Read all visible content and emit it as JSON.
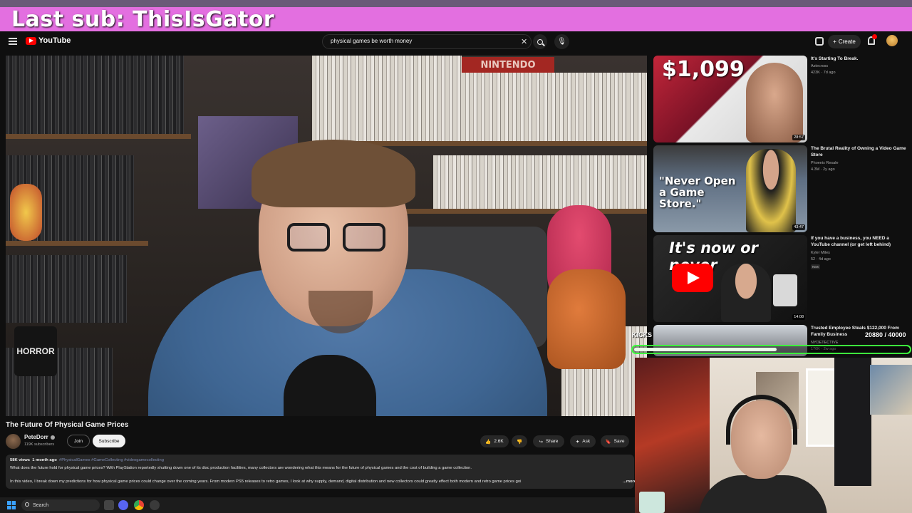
{
  "stream_overlay": {
    "banner": "Last sub: ThisIsGator",
    "goal_label": "KICKS",
    "goal_count": "20880 / 40000",
    "goal_fraction": 0.52
  },
  "header": {
    "logo_text": "YouTube",
    "search_value": "physical games be worth money",
    "create_label": "Create"
  },
  "video": {
    "title": "The Future Of Physical Game Prices",
    "channel": "PeteDorr",
    "subscribers": "119K subscribers",
    "join_label": "Join",
    "subscribe_label": "Subscribe",
    "likes": "2.6K",
    "share_label": "Share",
    "ask_label": "Ask",
    "save_label": "Save",
    "scene_sign": "NINTENDO",
    "scene_mug": "HORROR"
  },
  "description": {
    "views": "58K views",
    "age": "1 month ago",
    "tags": "#PhysicalGames #GameCollecting #videogamecollecting",
    "line1": "What does the future hold for physical game prices? With PlayStation reportedly shutting down one of its disc production facilities, many collectors are wondering what this means for the future of physical games and the cost of building a game collection.",
    "line2": "In this video, I break down my predictions for how physical game prices could change over the coming years. From modern PS5 releases to retro games, I look at why supply, demand, digital distribution and new collectors could greatly effect both modern and retro game prices goi",
    "more": "...more"
  },
  "related": [
    {
      "title": "It's Starting To Break.",
      "channel": "Astecross",
      "meta": "423K · 7d ago",
      "duration": "28:57",
      "thumb_text": "$1,099"
    },
    {
      "title": "The Brutal Reality of Owning a Video Game Store",
      "channel": "Phoenix Resale",
      "meta": "4.3M · 2y ago",
      "duration": "43:47",
      "thumb_text": "\"Never Open a Game Store.\""
    },
    {
      "title": "If you have a business, you NEED a YouTube channel (or get left behind)",
      "channel": "Kyler Miles",
      "meta": "52 · 4d ago",
      "badge": "New",
      "duration": "14:08",
      "thumb_text": "It's now or never"
    },
    {
      "title": "Trusted Employee Steals $122,000 From Family Business",
      "channel": "NYDETECTIVE",
      "meta": "176K · 2w ago"
    }
  ],
  "taskbar": {
    "search_label": "Search"
  },
  "colors": {
    "accent": "#ff0000",
    "banner": "#e36fe0",
    "goal_border": "#3dff3d"
  }
}
